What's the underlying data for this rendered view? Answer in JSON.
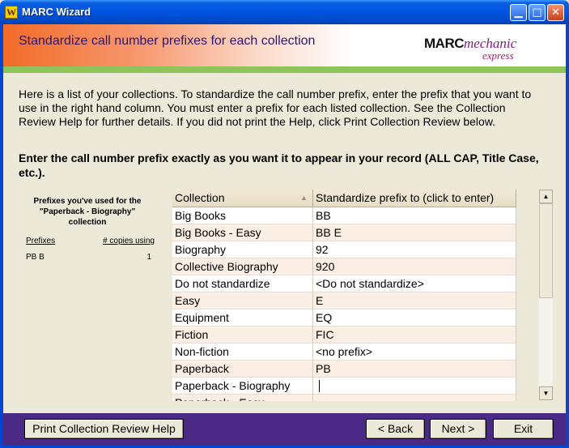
{
  "window": {
    "title": "MARC Wizard",
    "icon_glyph": "W"
  },
  "banner": {
    "title": "Standardize call number prefixes for each collection",
    "logo_part1": "MARC",
    "logo_part2": "mechanic",
    "logo_part3": "express"
  },
  "intro_text": "Here is a list of your collections. To standardize the call number prefix, enter the prefix that you want to use in the right hand column. You must enter a prefix for each listed collection. See the Collection Review Help for further details. If you did not print the Help, click Print Collection Review below.",
  "instruction_text": "Enter the call number prefix exactly as you want it to appear in your record (ALL CAP, Title Case, etc.).",
  "side_panel": {
    "heading": "Prefixes you've used for the \"Paperback - Biography\" collection",
    "col_prefixes": "Prefixes",
    "col_copies": "# copies using",
    "rows": [
      {
        "prefix": "PB B",
        "copies": "1"
      }
    ]
  },
  "grid": {
    "headers": [
      "Collection",
      "Standardize prefix to (click to enter)"
    ],
    "rows": [
      {
        "collection": "Big Books",
        "prefix": "BB"
      },
      {
        "collection": "Big Books - Easy",
        "prefix": "BB E"
      },
      {
        "collection": "Biography",
        "prefix": "92"
      },
      {
        "collection": "Collective Biography",
        "prefix": "920"
      },
      {
        "collection": "Do not standardize",
        "prefix": "<Do not standardize>"
      },
      {
        "collection": "Easy",
        "prefix": "E"
      },
      {
        "collection": "Equipment",
        "prefix": "EQ"
      },
      {
        "collection": "Fiction",
        "prefix": "FIC"
      },
      {
        "collection": "Non-fiction",
        "prefix": "<no prefix>"
      },
      {
        "collection": "Paperback",
        "prefix": "PB"
      },
      {
        "collection": "Paperback - Biography",
        "prefix": ""
      },
      {
        "collection": "Paperback - Easy",
        "prefix": ""
      }
    ]
  },
  "footer": {
    "print_help": "Print Collection Review Help",
    "back": "< Back",
    "next": "Next >",
    "exit": "Exit"
  },
  "colors": {
    "footer_bg": "#4b2a86",
    "banner_accent": "#f26b28",
    "green_strip": "#8fc45a",
    "row_alt": "#fbeee4"
  }
}
